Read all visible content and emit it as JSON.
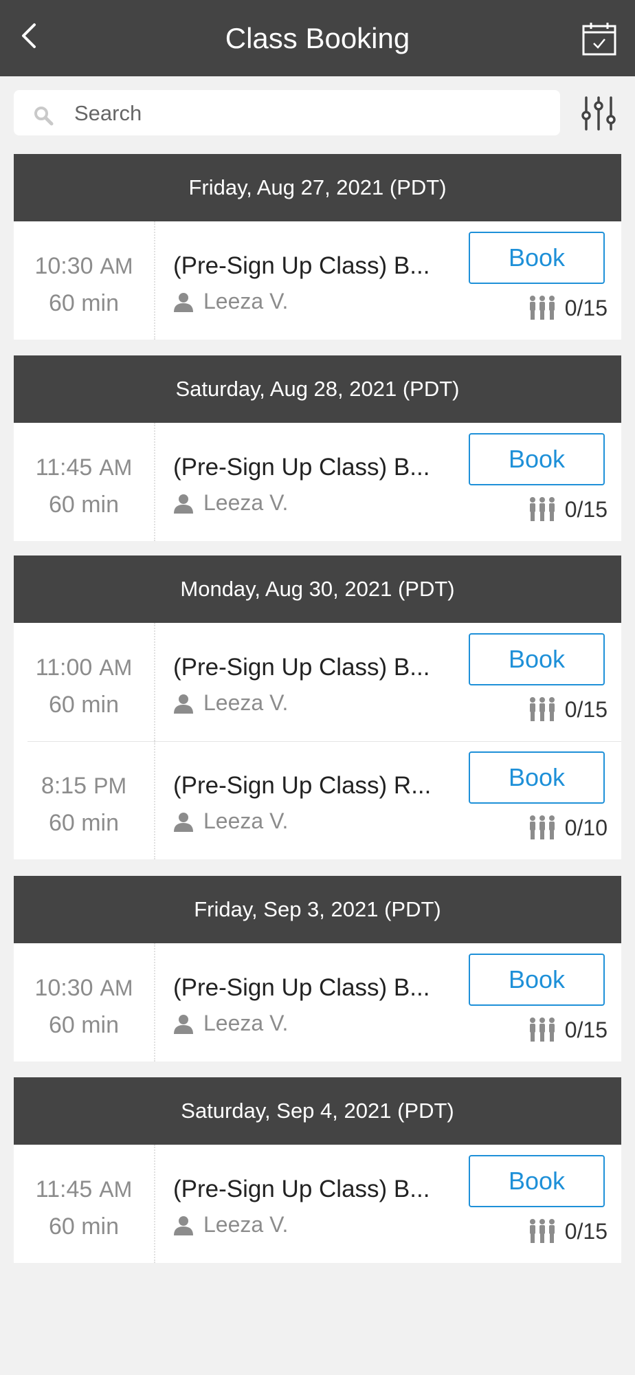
{
  "header": {
    "title": "Class Booking",
    "back_icon": "chevron-left-icon",
    "calendar_icon": "calendar-check-icon"
  },
  "search": {
    "placeholder": "Search",
    "value": ""
  },
  "filter_icon": "sliders-icon",
  "colors": {
    "header_bg": "#444444",
    "accent": "#1e90d8",
    "page_bg": "#f1f1f1"
  },
  "days": [
    {
      "date": "Friday, Aug 27, 2021 (PDT)",
      "classes": [
        {
          "time": "10:30",
          "ampm": "AM",
          "duration": "60 min",
          "name": "(Pre-Sign Up Class) B...",
          "instructor": "Leeza V.",
          "book_label": "Book",
          "capacity": "0/15"
        }
      ]
    },
    {
      "date": "Saturday, Aug 28, 2021 (PDT)",
      "classes": [
        {
          "time": "11:45",
          "ampm": "AM",
          "duration": "60 min",
          "name": "(Pre-Sign Up Class) B...",
          "instructor": "Leeza V.",
          "book_label": "Book",
          "capacity": "0/15"
        }
      ]
    },
    {
      "date": "Monday, Aug 30, 2021 (PDT)",
      "classes": [
        {
          "time": "11:00",
          "ampm": "AM",
          "duration": "60 min",
          "name": "(Pre-Sign Up Class) B...",
          "instructor": "Leeza V.",
          "book_label": "Book",
          "capacity": "0/15"
        },
        {
          "time": "8:15",
          "ampm": "PM",
          "duration": "60 min",
          "name": "(Pre-Sign Up Class) R...",
          "instructor": "Leeza V.",
          "book_label": "Book",
          "capacity": "0/10"
        }
      ]
    },
    {
      "date": "Friday, Sep 3, 2021 (PDT)",
      "classes": [
        {
          "time": "10:30",
          "ampm": "AM",
          "duration": "60 min",
          "name": "(Pre-Sign Up Class) B...",
          "instructor": "Leeza V.",
          "book_label": "Book",
          "capacity": "0/15"
        }
      ]
    },
    {
      "date": "Saturday, Sep 4, 2021 (PDT)",
      "classes": [
        {
          "time": "11:45",
          "ampm": "AM",
          "duration": "60 min",
          "name": "(Pre-Sign Up Class) B...",
          "instructor": "Leeza V.",
          "book_label": "Book",
          "capacity": "0/15"
        }
      ]
    }
  ]
}
